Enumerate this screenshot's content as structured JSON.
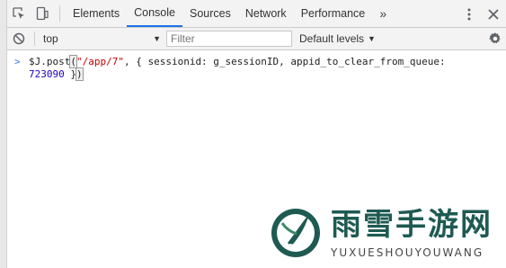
{
  "tabs": {
    "items": [
      "Elements",
      "Console",
      "Sources",
      "Network",
      "Performance"
    ],
    "more": "»",
    "active_index": 1
  },
  "toolbar": {
    "context": "top",
    "filter_placeholder": "Filter",
    "levels_label": "Default levels"
  },
  "console": {
    "prompt": ">",
    "code_prefix": "$J.post",
    "code_open_paren": "(",
    "code_string": "\"/app/7\"",
    "code_mid": ", { sessionid: g_sessionID, appid_to_clear_from_queue:",
    "code_number": "723090",
    "code_close": " }",
    "code_close_paren": ")"
  },
  "watermark": {
    "title": "雨雪手游网",
    "subtitle": "YUXUESHOUYOUWANG"
  },
  "colors": {
    "accent": "#1a73e8",
    "string": "#c80000",
    "number": "#1c00cf",
    "watermark": "#1e5a52"
  }
}
